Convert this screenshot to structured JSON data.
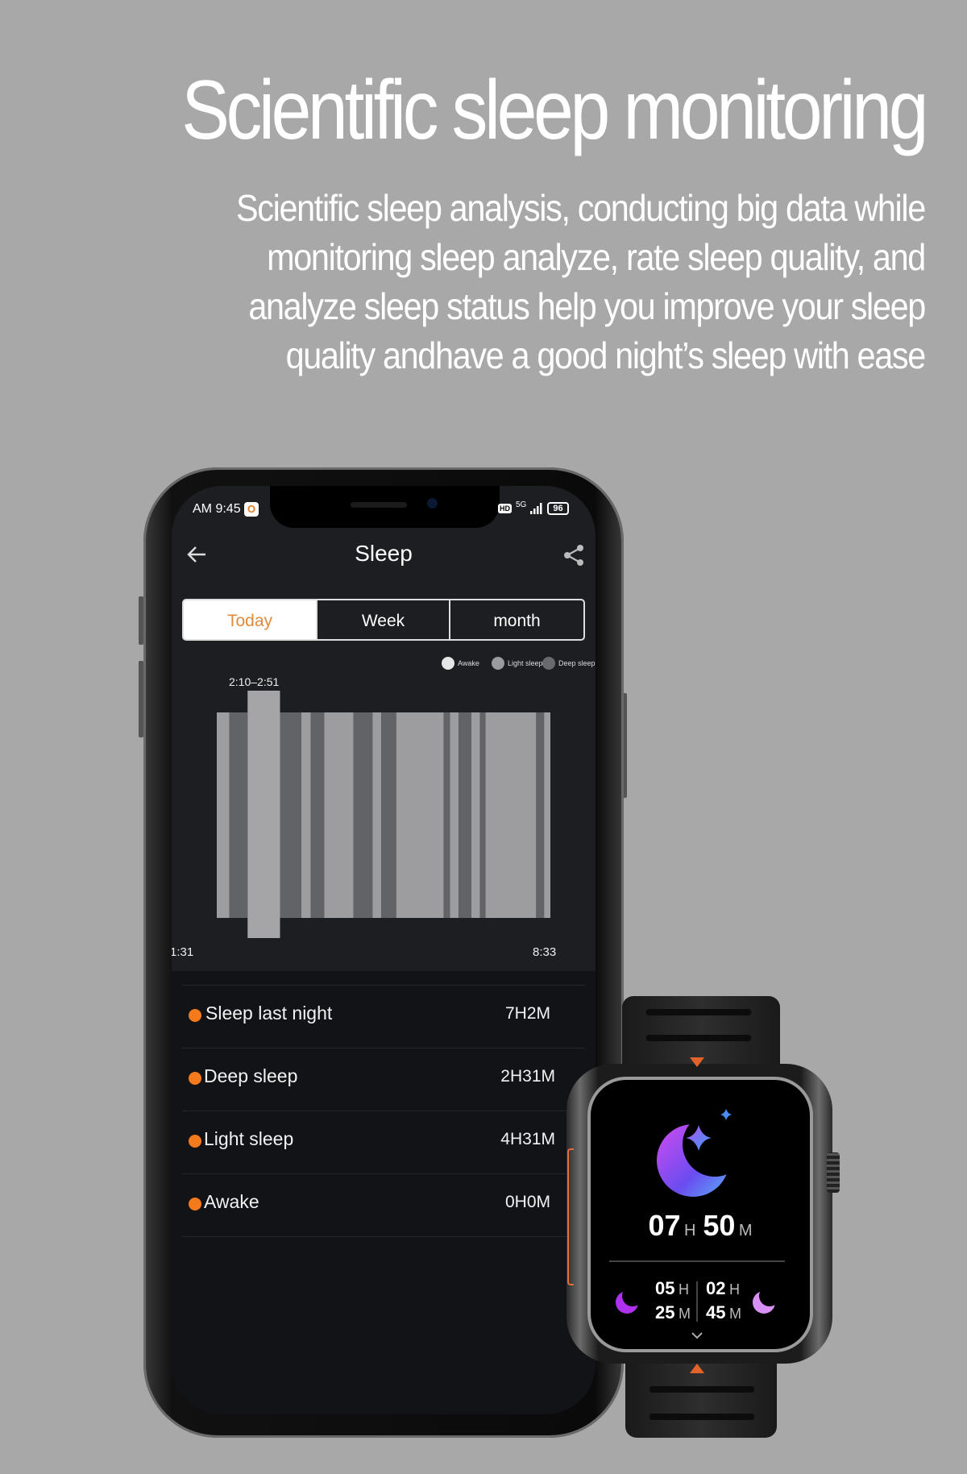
{
  "headline": "Scientific sleep monitoring",
  "description_lines": [
    "Scientific sleep analysis, conducting big data while",
    "monitoring sleep analyze, rate sleep quality, and",
    "analyze sleep status help you improve your sleep",
    "quality andhave a good night’s sleep with ease"
  ],
  "phone": {
    "status_bar": {
      "time": "AM 9:45",
      "app_badge": "O",
      "hd": "HD",
      "network": "5G",
      "battery": "96"
    },
    "header": {
      "title": "Sleep",
      "back_icon": "arrow-left-icon",
      "share_icon": "share-icon"
    },
    "tabs": [
      {
        "label": "Today",
        "active": true
      },
      {
        "label": "Week",
        "active": false
      },
      {
        "label": "month",
        "active": false
      }
    ],
    "legend": [
      {
        "label": "Awake",
        "color": "#e6e6e6"
      },
      {
        "label": "Light sleep",
        "color": "#9b9b9d"
      },
      {
        "label": "Deep sleep",
        "color": "#6a6a6c"
      }
    ],
    "summary": [
      {
        "label": "Sleep last night",
        "value": "7H2M"
      },
      {
        "label": "Deep sleep",
        "value": "2H31M"
      },
      {
        "label": "Light sleep",
        "value": "4H31M"
      },
      {
        "label": "Awake",
        "value": "0H0M"
      }
    ],
    "accent_color": "#f57a1c"
  },
  "chart_data": {
    "type": "bar",
    "subtype": "sleep-stage-timeline",
    "x_start": "1:31",
    "x_end": "8:33",
    "tick_labels": [
      "1:31",
      "8:33"
    ],
    "selected_label": "2:10–2:51",
    "colors": {
      "Light sleep": "#9d9da0",
      "Deep sleep": "#626366",
      "selected": "#a5a5a8"
    },
    "segments": [
      {
        "start": "1:31",
        "end": "1:47",
        "stage": "Light sleep"
      },
      {
        "start": "1:47",
        "end": "2:10",
        "stage": "Deep sleep"
      },
      {
        "start": "2:10",
        "end": "2:51",
        "stage": "Light sleep",
        "selected": true
      },
      {
        "start": "2:51",
        "end": "3:18",
        "stage": "Deep sleep"
      },
      {
        "start": "3:18",
        "end": "3:30",
        "stage": "Light sleep"
      },
      {
        "start": "3:30",
        "end": "3:47",
        "stage": "Deep sleep"
      },
      {
        "start": "3:47",
        "end": "4:24",
        "stage": "Light sleep"
      },
      {
        "start": "4:24",
        "end": "4:48",
        "stage": "Deep sleep"
      },
      {
        "start": "4:48",
        "end": "4:59",
        "stage": "Light sleep"
      },
      {
        "start": "4:59",
        "end": "5:18",
        "stage": "Deep sleep"
      },
      {
        "start": "5:18",
        "end": "6:18",
        "stage": "Light sleep"
      },
      {
        "start": "6:18",
        "end": "6:26",
        "stage": "Deep sleep"
      },
      {
        "start": "6:26",
        "end": "6:37",
        "stage": "Light sleep"
      },
      {
        "start": "6:37",
        "end": "6:53",
        "stage": "Deep sleep"
      },
      {
        "start": "6:53",
        "end": "7:04",
        "stage": "Light sleep"
      },
      {
        "start": "7:04",
        "end": "7:11",
        "stage": "Deep sleep"
      },
      {
        "start": "7:11",
        "end": "8:15",
        "stage": "Light sleep"
      },
      {
        "start": "8:15",
        "end": "8:25",
        "stage": "Deep sleep"
      },
      {
        "start": "8:25",
        "end": "8:33",
        "stage": "Light sleep"
      }
    ]
  },
  "watch": {
    "total": {
      "hours": "07",
      "hours_unit": "H",
      "minutes": "50",
      "minutes_unit": "M"
    },
    "left": {
      "hours": "05",
      "hours_unit": "H",
      "minutes": "25",
      "minutes_unit": "M"
    },
    "right": {
      "hours": "02",
      "hours_unit": "H",
      "minutes": "45",
      "minutes_unit": "M"
    },
    "icon": "moon-stars-icon"
  }
}
